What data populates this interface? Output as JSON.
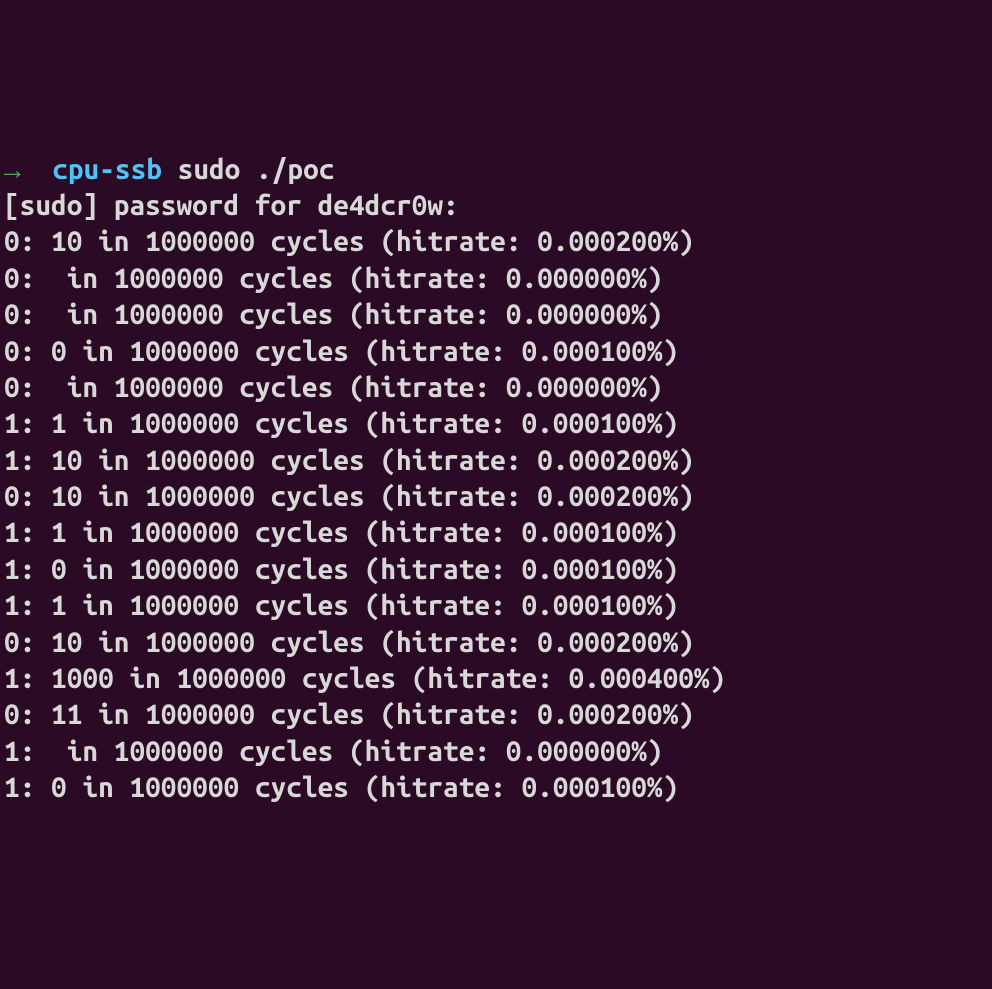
{
  "prompt": {
    "arrow": "→",
    "hostname": "cpu-ssb",
    "command": "sudo ./poc"
  },
  "sudo_prompt": "[sudo] password for de4dcr0w:",
  "lines": [
    "0: 10 in 1000000 cycles (hitrate: 0.000200%)",
    "0:  in 1000000 cycles (hitrate: 0.000000%)",
    "0:  in 1000000 cycles (hitrate: 0.000000%)",
    "0: 0 in 1000000 cycles (hitrate: 0.000100%)",
    "0:  in 1000000 cycles (hitrate: 0.000000%)",
    "1: 1 in 1000000 cycles (hitrate: 0.000100%)",
    "1: 10 in 1000000 cycles (hitrate: 0.000200%)",
    "0: 10 in 1000000 cycles (hitrate: 0.000200%)",
    "1: 1 in 1000000 cycles (hitrate: 0.000100%)",
    "1: 0 in 1000000 cycles (hitrate: 0.000100%)",
    "1: 1 in 1000000 cycles (hitrate: 0.000100%)",
    "0: 10 in 1000000 cycles (hitrate: 0.000200%)",
    "1: 1000 in 1000000 cycles (hitrate: 0.000400%)",
    "0: 11 in 1000000 cycles (hitrate: 0.000200%)",
    "1:  in 1000000 cycles (hitrate: 0.000000%)",
    "1: 0 in 1000000 cycles (hitrate: 0.000100%)"
  ]
}
